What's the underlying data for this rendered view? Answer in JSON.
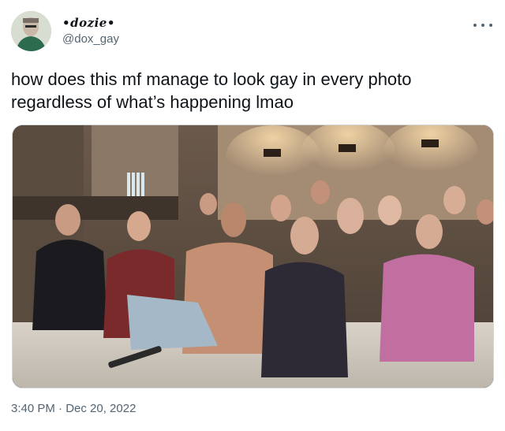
{
  "tweet": {
    "display_name": "•dozie•",
    "handle": "@dox_gay",
    "text": "how does this mf manage to look gay in every photo\nregardless of what’s happening lmao",
    "timestamp": "3:40 PM · Dec 20, 2022",
    "media_alt": "photo of a group of people sitting on a couch in a dim room watching something",
    "colors": {
      "text": "#0f1419",
      "secondary": "#536471",
      "border": "#cfd9de"
    },
    "icons": {
      "more": "more-options-icon"
    }
  }
}
